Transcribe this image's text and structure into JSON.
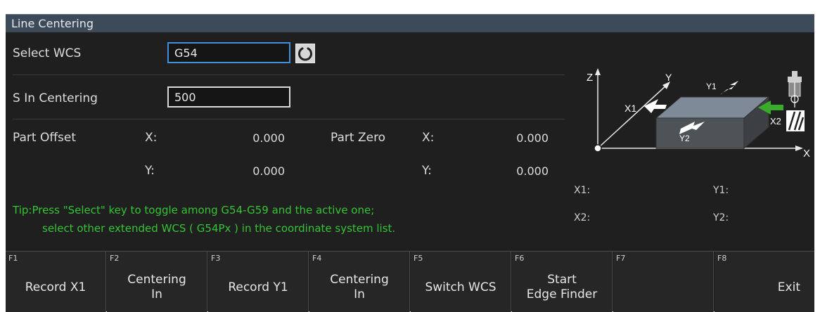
{
  "title": "Line Centering",
  "select_wcs": {
    "label": "Select WCS",
    "value": "G54",
    "refresh_icon": "refresh-icon"
  },
  "spindle": {
    "label": "S In Centering",
    "value": "500"
  },
  "part_offset": {
    "label": "Part Offset",
    "x_label": "X:",
    "x_value": "0.000",
    "y_label": "Y:",
    "y_value": "0.000"
  },
  "part_zero": {
    "label": "Part Zero",
    "x_label": "X:",
    "x_value": "0.000",
    "y_label": "Y:",
    "y_value": "0.000"
  },
  "tip": {
    "line1": "Tip:Press \"Select\" key to toggle among G54-G59 and the active one;",
    "line2": "select other extended WCS ( G54Px ) in the coordinate system list."
  },
  "diagram": {
    "axis_z": "Z",
    "axis_x": "X",
    "axis_y": "Y",
    "tag_x1": "X1",
    "tag_y1": "Y1",
    "tag_x2": "X2",
    "tag_y2": "Y2"
  },
  "recorded": {
    "x1": "X1:",
    "y1": "Y1:",
    "x2": "X2:",
    "y2": "Y2:"
  },
  "fkeys": [
    {
      "num": "F1",
      "label": "Record X1"
    },
    {
      "num": "F2",
      "label": "Centering\nIn"
    },
    {
      "num": "F3",
      "label": "Record Y1"
    },
    {
      "num": "F4",
      "label": "Centering\nIn"
    },
    {
      "num": "F5",
      "label": "Switch WCS"
    },
    {
      "num": "F6",
      "label": "Start\nEdge Finder"
    },
    {
      "num": "F7",
      "label": ""
    },
    {
      "num": "F8",
      "label": "Exit"
    }
  ],
  "colors": {
    "tip": "#35c435",
    "focus_border": "#3f8ee0",
    "arrow_green": "#3aaa2a",
    "title_bar": "#3d4a5a"
  }
}
